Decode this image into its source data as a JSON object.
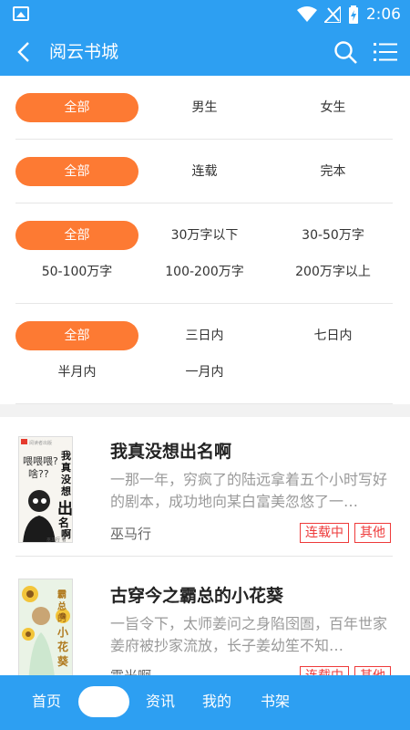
{
  "status_bar": {
    "time": "2:06",
    "icons": [
      "image-icon",
      "wifi-icon",
      "signal-icon",
      "battery-icon"
    ]
  },
  "app_bar": {
    "title": "阅云书城",
    "icons": [
      "back-icon",
      "search-icon",
      "menu-list-icon"
    ]
  },
  "filters": {
    "gender": {
      "options": [
        "全部",
        "男生",
        "女生"
      ],
      "selected": "全部"
    },
    "status": {
      "options": [
        "全部",
        "连载",
        "完本"
      ],
      "selected": "全部"
    },
    "word_count": {
      "options": [
        "全部",
        "30万字以下",
        "30-50万字",
        "50-100万字",
        "100-200万字",
        "200万字以上"
      ],
      "selected": "全部"
    },
    "update_time": {
      "options": [
        "全部",
        "三日内",
        "七日内",
        "半月内",
        "一月内"
      ],
      "selected": "全部"
    }
  },
  "books": [
    {
      "title": "我真没想出名啊",
      "description": "一那一年，穷疯了的陆远拿着五个小时写好的剧本，成功地向某白富美忽悠了一…",
      "author": "巫马行",
      "tags": [
        "连载中",
        "其他"
      ],
      "cover_text": {
        "publisher": "阅读者出版",
        "title_chars": "我真没想出名啊",
        "bubble": "喂喂喂？啥？？",
        "author_line": "巫马行 著"
      }
    },
    {
      "title": "古穿今之霸总的小花葵",
      "description": "一旨令下，太师姜问之身陷囹圄，百年世家姜府被抄家流放，长子姜幼笙不知…",
      "author": "霞光啊",
      "tags": [
        "连载中",
        "其他"
      ],
      "cover_text": {
        "title_chars": "霸总的小花葵"
      }
    }
  ],
  "bottom_nav": {
    "items": [
      "首页",
      "资讯",
      "我的",
      "书架"
    ]
  },
  "colors": {
    "primary": "#2d9ff2",
    "accent": "#fd7a33",
    "tag": "#ee3a3a"
  }
}
